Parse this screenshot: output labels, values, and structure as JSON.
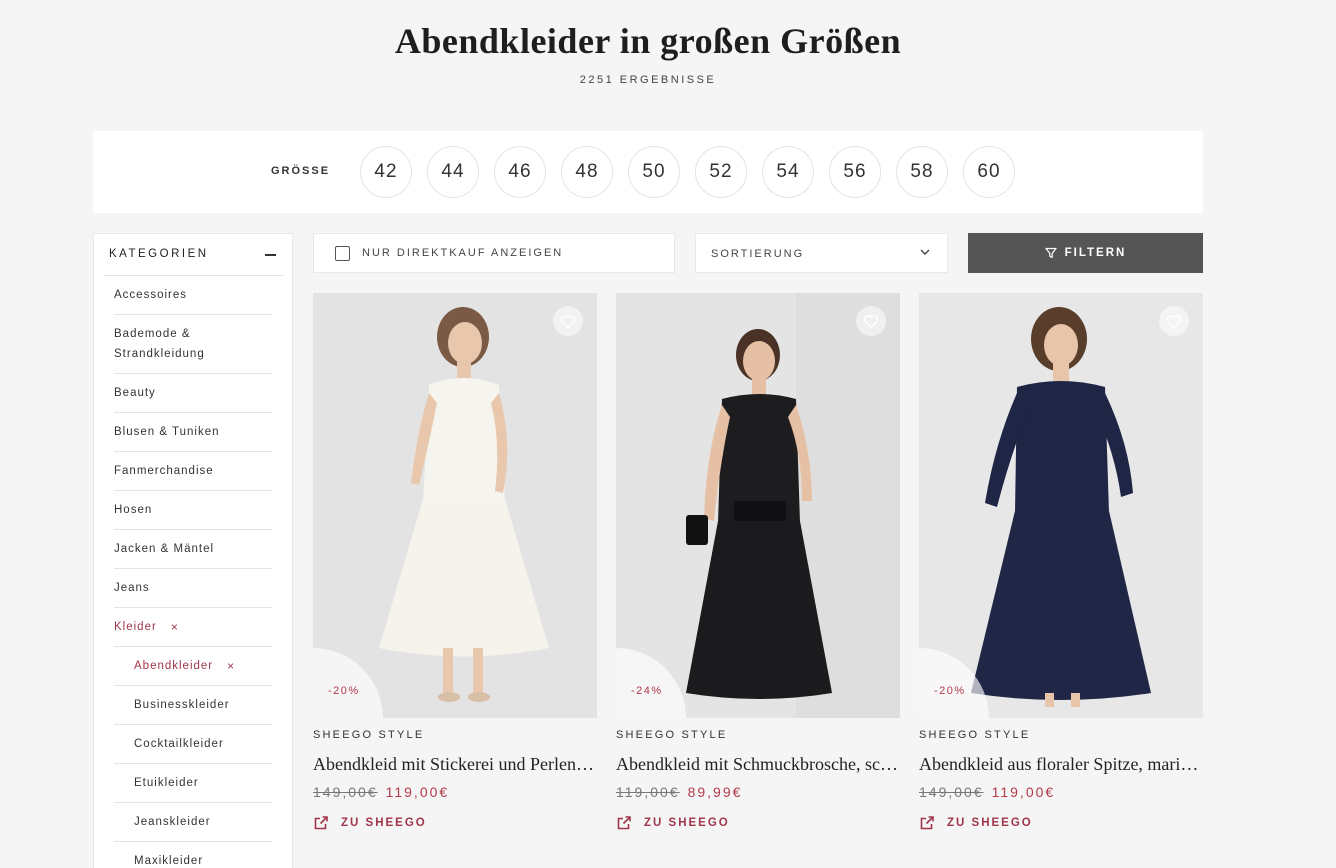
{
  "header": {
    "title": "Abendkleider in großen Größen",
    "result_count": "2251 ERGEBNISSE"
  },
  "size_filter": {
    "label": "GRÖSSE",
    "sizes": [
      "42",
      "44",
      "46",
      "48",
      "50",
      "52",
      "54",
      "56",
      "58",
      "60"
    ]
  },
  "sidebar": {
    "title": "KATEGORIEN",
    "items": [
      {
        "label": "Accessoires"
      },
      {
        "label": "Bademode & Strandkleidung"
      },
      {
        "label": "Beauty"
      },
      {
        "label": "Blusen & Tuniken"
      },
      {
        "label": "Fanmerchandise"
      },
      {
        "label": "Hosen"
      },
      {
        "label": "Jacken & Mäntel"
      },
      {
        "label": "Jeans"
      },
      {
        "label": "Kleider",
        "remove": "×"
      },
      {
        "label": "Abendkleider",
        "remove": "×"
      },
      {
        "label": "Businesskleider"
      },
      {
        "label": "Cocktailkleider"
      },
      {
        "label": "Etuikleider"
      },
      {
        "label": "Jeanskleider"
      },
      {
        "label": "Maxikleider"
      }
    ]
  },
  "toolbar": {
    "direct_buy_label": "NUR DIREKTKAUF ANZEIGEN",
    "sort_label": "SORTIERUNG",
    "filter_label": "FILTERN"
  },
  "products": [
    {
      "brand": "SHEEGO STYLE",
      "name": "Abendkleid mit Stickerei und Perlen…",
      "old_price": "149,00€",
      "new_price": "119,00€",
      "discount": "-20%",
      "link_label": "ZU SHEEGO",
      "dress_color": "#f4f2ec",
      "background": "#e6e6e6"
    },
    {
      "brand": "SHEEGO STYLE",
      "name": "Abendkleid mit Schmuckbrosche, sc…",
      "old_price": "119,00€",
      "new_price": "89,99€",
      "discount": "-24%",
      "link_label": "ZU SHEEGO",
      "dress_color": "#1b1b1d",
      "background": "#e4e4e4"
    },
    {
      "brand": "SHEEGO STYLE",
      "name": "Abendkleid aus floraler Spitze, mari…",
      "old_price": "149,00€",
      "new_price": "119,00€",
      "discount": "-20%",
      "link_label": "ZU SHEEGO",
      "dress_color": "#1c2240",
      "background": "#e7e7e7"
    }
  ],
  "colors": {
    "accent": "#a0354a",
    "sale": "#b23a4a",
    "filter_button": "#555555"
  }
}
